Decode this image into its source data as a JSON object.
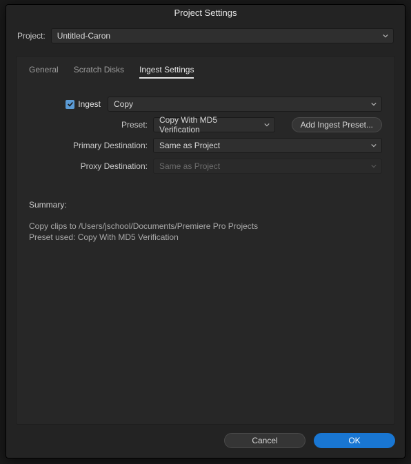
{
  "dialog": {
    "title": "Project Settings",
    "project_label": "Project:",
    "project_value": "Untitled-Caron"
  },
  "tabs": {
    "general": "General",
    "scratch": "Scratch Disks",
    "ingest": "Ingest Settings"
  },
  "ingest": {
    "checkbox_label": "Ingest",
    "method_value": "Copy",
    "preset_label": "Preset:",
    "preset_value": "Copy With MD5 Verification",
    "add_preset_button": "Add Ingest Preset...",
    "primary_label": "Primary Destination:",
    "primary_value": "Same as Project",
    "proxy_label": "Proxy Destination:",
    "proxy_value": "Same as Project"
  },
  "summary": {
    "heading": "Summary:",
    "line1": "Copy clips to /Users/jschool/Documents/Premiere Pro Projects",
    "line2": "Preset used: Copy With MD5 Verification"
  },
  "footer": {
    "cancel": "Cancel",
    "ok": "OK"
  }
}
